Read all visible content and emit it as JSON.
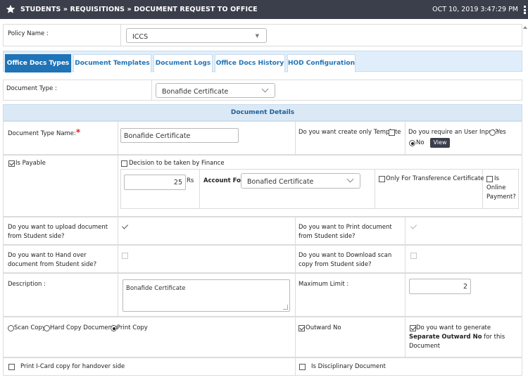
{
  "header": {
    "breadcrumb": "STUDENTS » REQUISITIONS » DOCUMENT REQUEST TO OFFICE",
    "datetime": "OCT 10, 2019  3:47:29 PM"
  },
  "policy": {
    "label": "Policy Name :",
    "value": "ICCS"
  },
  "tabs": [
    {
      "label": "Office Docs Types",
      "active": true
    },
    {
      "label": "Document Templates"
    },
    {
      "label": "Document Logs"
    },
    {
      "label": "Office Docs History"
    },
    {
      "label": "HOD Configuration"
    }
  ],
  "document_type": {
    "label": "Document Type :",
    "value": "Bonafide Certificate"
  },
  "section_title": "Document Details",
  "details": {
    "type_name_label": "Document Type Name:",
    "required_mark": "*",
    "type_name_value": "Bonafide Certificate",
    "only_template_label": "Do you want create only Template",
    "user_input_label": "Do you require an User Input?",
    "yes_label": "Yes",
    "no_label": "No",
    "view_button": "View",
    "is_payable_label": "Is Payable",
    "finance_label": "Decision to be taken by Finance",
    "amount_value": "25",
    "amount_unit": "Rs",
    "account_for_label": "Account For",
    "account_for_value": "Bonafied Certificate",
    "transference_label": "Only For Transference Certificate",
    "online_payment_label": "Is Online Payment?",
    "upload_label": "Do you want to upload document from Student side?",
    "print_label": "Do you want to Print document from Student side?",
    "handover_label": "Do you want to Hand over document from Student side?",
    "download_label": "Do you want to Download scan copy from Student side?",
    "description_label": "Description :",
    "description_value": "Bonafide Certificate",
    "max_limit_label": "Maximum Limit :",
    "max_limit_value": "2",
    "scan_copy_label": "Scan Copy",
    "hard_copy_label": "Hard Copy Documents",
    "print_copy_label": "Print Copy",
    "outward_label": "Outward No",
    "separate_outward_pre": "Do you want to generate",
    "separate_outward_bold": "Separate Outward No",
    "separate_outward_post": "for this Document",
    "icard_label": "Print I-Card copy for handover side",
    "disciplinary_label": "Is Disciplinary Document"
  }
}
